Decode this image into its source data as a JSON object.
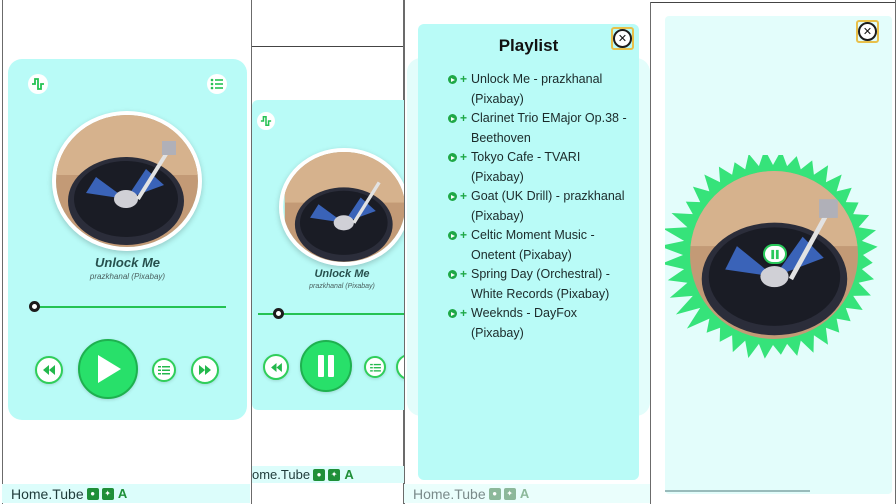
{
  "footer": {
    "brand": "Home.Tube"
  },
  "player": {
    "title": "Unlock Me",
    "artist": "prazkhanal (Pixabay)",
    "progress": 0.0
  },
  "playlist": {
    "heading": "Playlist",
    "close_icon": "✕",
    "items": [
      {
        "name": "Unlock Me - prazkhanal (Pixabay)"
      },
      {
        "name": "Clarinet Trio EMajor Op.38 - Beethoven"
      },
      {
        "name": "Tokyo Cafe - TVARI (Pixabay)"
      },
      {
        "name": "Goat (UK Drill) - prazkhanal (Pixabay)"
      },
      {
        "name": "Celtic Moment Music - Onetent (Pixabay)"
      },
      {
        "name": "Spring Day (Orchestral) - White Records (Pixabay)"
      },
      {
        "name": "Weeknds - DayFox (Pixabay)"
      }
    ]
  },
  "colors": {
    "panel": "#b9fbf7",
    "accent": "#28e06a",
    "accent_dark": "#1fa847"
  },
  "icons": {
    "wave": "waveform-icon",
    "list": "playlist-icon",
    "prev": "rewind-icon",
    "play": "play-icon",
    "pause": "pause-icon",
    "next": "fast-forward-icon",
    "queue": "queue-icon",
    "close": "close-icon"
  }
}
